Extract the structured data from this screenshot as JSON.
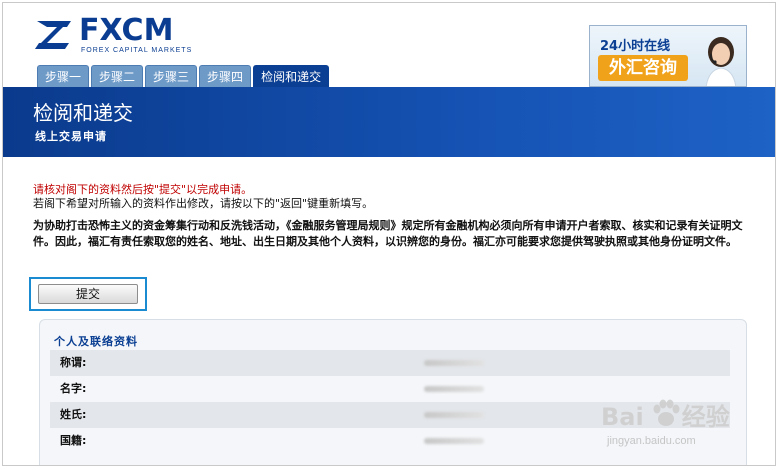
{
  "header": {
    "logo_text": "FXCM",
    "logo_tagline": "FOREX CAPITAL MARKETS",
    "tabs": [
      {
        "label": "步骤一",
        "active": false
      },
      {
        "label": "步骤二",
        "active": false
      },
      {
        "label": "步骤三",
        "active": false
      },
      {
        "label": "步骤四",
        "active": false
      },
      {
        "label": "检阅和递交",
        "active": true
      }
    ],
    "promo": {
      "line1": "24小时在线",
      "line2": "外汇咨询"
    }
  },
  "banner": {
    "title": "检阅和递交",
    "subtitle": "线上交易申请"
  },
  "main": {
    "instruction_red": "请核对阁下的资料然后按\"提交\"以完成申请。",
    "instruction_plain": "若阁下希望对所输入的资料作出修改，请按以下的\"返回\"键重新填写。",
    "notice": "为协助打击恐怖主义的资金筹集行动和反洗钱活动，《金融服务管理局规则》规定所有金融机构必须向所有申请开户者索取、核实和记录有关证明文件。因此，福汇有责任索取您的姓名、地址、出生日期及其他个人资料，以识辨您的身份。福汇亦可能要求您提供驾驶执照或其他身份证明文件。",
    "submit_label": "提交"
  },
  "info_panel": {
    "title": "个人及联络资料",
    "rows": [
      {
        "label": "称谓:"
      },
      {
        "label": "名字:"
      },
      {
        "label": "姓氏:"
      },
      {
        "label": "国籍:"
      }
    ]
  },
  "watermark": {
    "text_left": "Bai",
    "text_right": "经验",
    "url": "jingyan.baidu.com"
  },
  "colors": {
    "brand_blue": "#0b3f93",
    "tab_inactive": "#6e9ac8",
    "notice_red": "#c00000",
    "focus_border": "#1a8bd1"
  }
}
